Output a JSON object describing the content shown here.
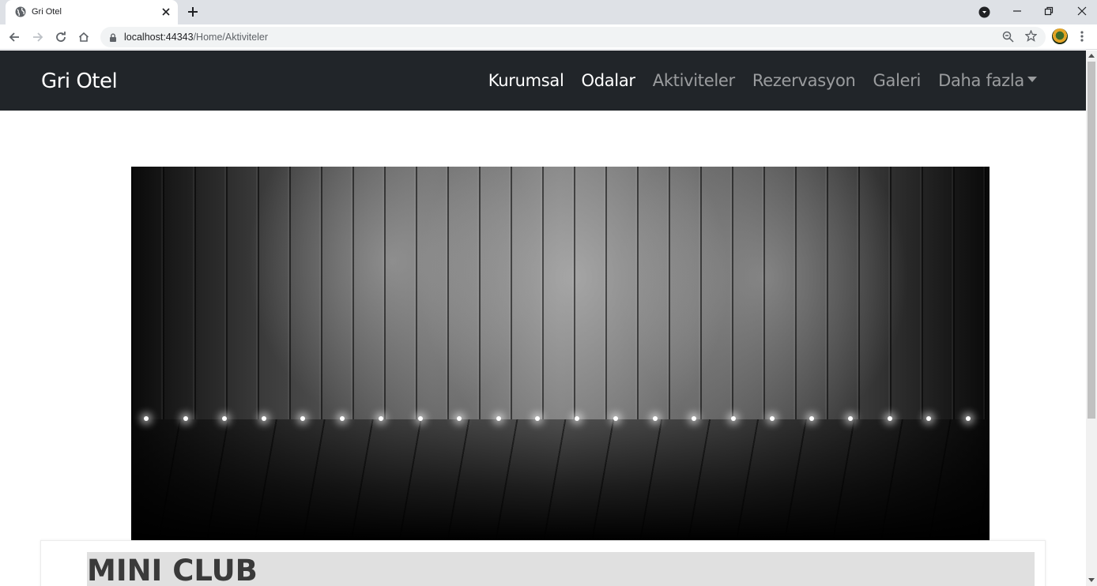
{
  "browser": {
    "tab_title": "Gri Otel",
    "url_host": "localhost:44343",
    "url_path": "/Home/Aktiviteler"
  },
  "site": {
    "brand": "Gri Otel",
    "nav": [
      {
        "label": "Kurumsal",
        "active": true
      },
      {
        "label": "Odalar",
        "active": true
      },
      {
        "label": "Aktiviteler",
        "active": false
      },
      {
        "label": "Rezervasyon",
        "active": false
      },
      {
        "label": "Galeri",
        "active": false
      },
      {
        "label": "Daha fazla",
        "active": false
      }
    ]
  },
  "content": {
    "hero_image": "stage-spotlights-image",
    "card_title": "MINI CLUB"
  },
  "colors": {
    "navbar_bg": "#212529",
    "page_bg": "#ffffff",
    "title_bar_bg": "#e0e0e0"
  }
}
